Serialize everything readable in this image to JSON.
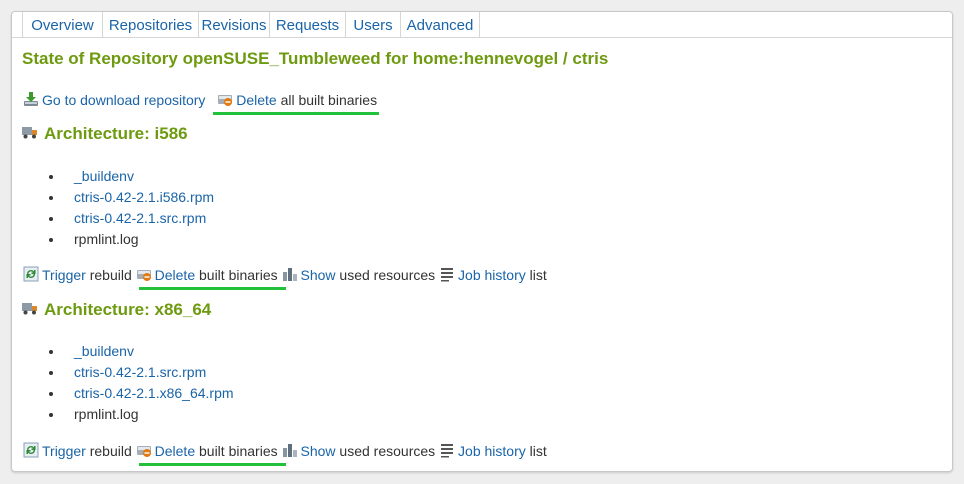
{
  "tabs": [
    "Overview",
    "Repositories",
    "Revisions",
    "Requests",
    "Users",
    "Advanced"
  ],
  "title": "State of Repository openSUSE_Tumbleweed for home:hennevogel / ctris",
  "top_actions": {
    "download_link": "Go to download repository",
    "delete_link": "Delete",
    "delete_text": "all built binaries"
  },
  "architectures": [
    {
      "label": "Architecture: i586",
      "files": [
        {
          "name": "_buildenv",
          "link": true
        },
        {
          "name": "ctris-0.42-2.1.i586.rpm",
          "link": true
        },
        {
          "name": "ctris-0.42-2.1.src.rpm",
          "link": true
        },
        {
          "name": "rpmlint.log",
          "link": false
        }
      ]
    },
    {
      "label": "Architecture: x86_64",
      "files": [
        {
          "name": "_buildenv",
          "link": true
        },
        {
          "name": "ctris-0.42-2.1.src.rpm",
          "link": true
        },
        {
          "name": "ctris-0.42-2.1.x86_64.rpm",
          "link": true
        },
        {
          "name": "rpmlint.log",
          "link": false
        }
      ]
    }
  ],
  "arch_actions": {
    "trigger_link": "Trigger",
    "trigger_text": "rebuild",
    "delete_link": "Delete",
    "delete_text": "built binaries",
    "show_link": "Show",
    "show_text": "used resources",
    "history_link": "Job history",
    "history_text": "list"
  },
  "colors": {
    "heading": "#6e9a10",
    "link": "#1a64a8",
    "highlight": "#22c13c"
  }
}
